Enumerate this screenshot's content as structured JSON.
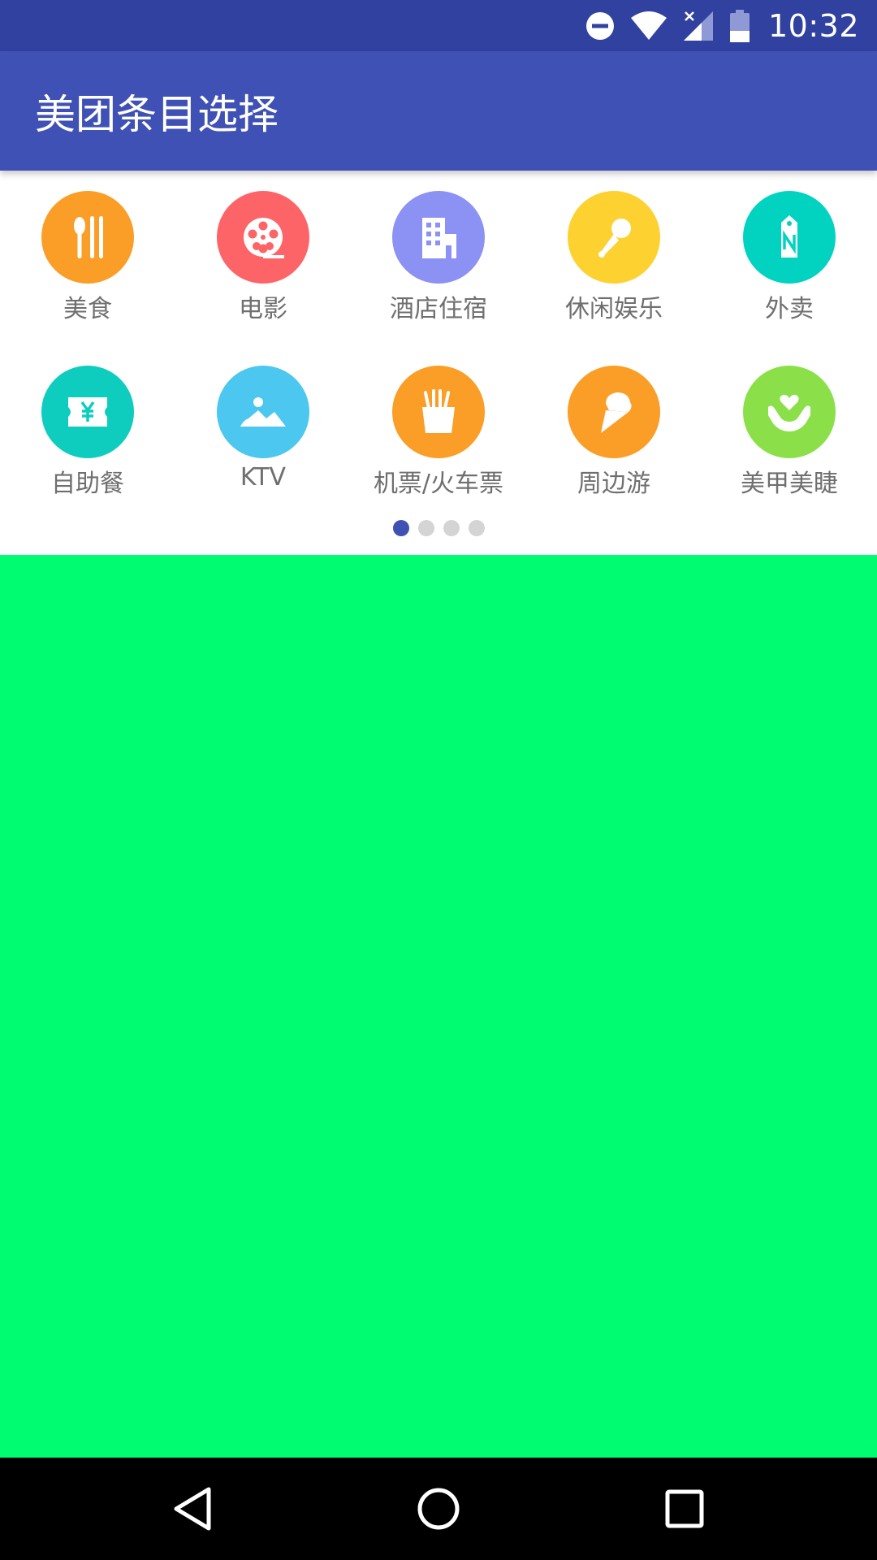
{
  "status_bar": {
    "time": "10:32",
    "icons": [
      "do-not-disturb-icon",
      "wifi-icon",
      "cell-signal-icon",
      "battery-icon"
    ]
  },
  "app_bar": {
    "title": "美团条目选择",
    "color": "#3f51b5"
  },
  "categories": [
    {
      "label": "美食",
      "icon": "fork-knife-icon",
      "color": "#fb9e27"
    },
    {
      "label": "电影",
      "icon": "film-reel-icon",
      "color": "#fd6468"
    },
    {
      "label": "酒店住宿",
      "icon": "hotel-building-icon",
      "color": "#8c91f4"
    },
    {
      "label": "休闲娱乐",
      "icon": "microphone-icon",
      "color": "#fdd130"
    },
    {
      "label": "外卖",
      "icon": "tag-icon",
      "color": "#02d3c1"
    },
    {
      "label": "自助餐",
      "icon": "voucher-icon",
      "color": "#0fcdbe"
    },
    {
      "label": "KTV",
      "icon": "landscape-photo-icon",
      "color": "#4cc7f0"
    },
    {
      "label": "机票/火车票",
      "icon": "fries-icon",
      "color": "#fb9e27"
    },
    {
      "label": "周边游",
      "icon": "ice-cream-icon",
      "color": "#fb9e27"
    },
    {
      "label": "美甲美睫",
      "icon": "hands-heart-icon",
      "color": "#8be04a"
    }
  ],
  "pager": {
    "page_count": 4,
    "active_index": 0
  },
  "content_panel": {
    "color": "#00fc70"
  },
  "nav_bar": {
    "buttons": [
      "back-icon",
      "home-icon",
      "recents-icon"
    ]
  }
}
